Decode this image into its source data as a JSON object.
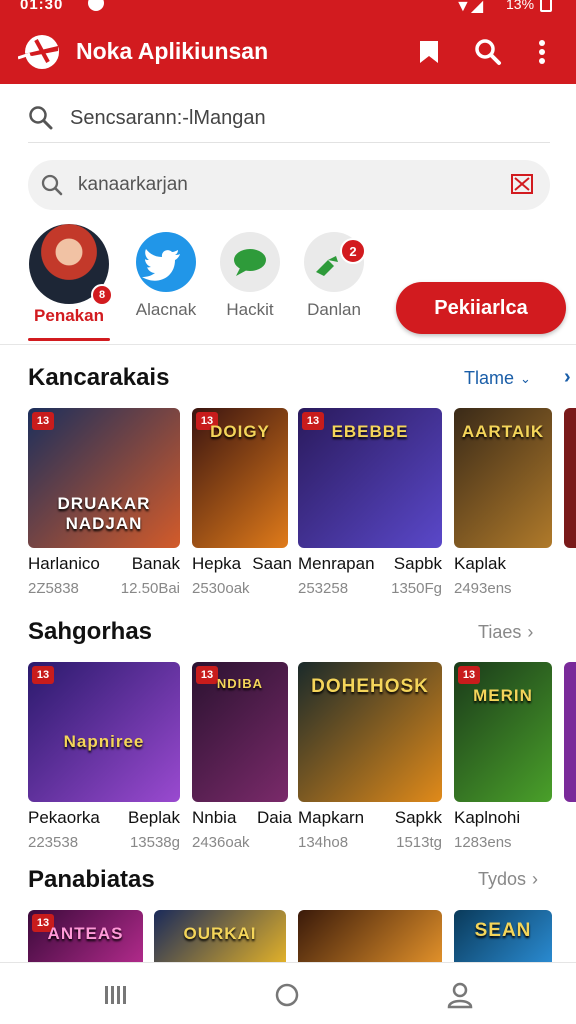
{
  "status_bar": {
    "time": "01:30",
    "battery": "13%"
  },
  "app_bar": {
    "title": "Noka Aplikiunsan",
    "icons": [
      "app-logo-icon",
      "bookmark-icon",
      "search-icon",
      "more-vertical-icon"
    ]
  },
  "search": {
    "main_placeholder": "Sencsarann:-lMangan",
    "filter_value": "kanaarkarjan"
  },
  "categories": [
    {
      "label": "Penakan",
      "icon": "avatar-icon",
      "badge": "8",
      "active": true
    },
    {
      "label": "Alacnak",
      "icon": "bird-icon"
    },
    {
      "label": "Hackit",
      "icon": "chat-icon"
    },
    {
      "label": "Danlan",
      "icon": "game-icon",
      "badge": "2"
    }
  ],
  "install_button": "Pekiiarlca",
  "sections": [
    {
      "title": "Kancarakais",
      "more": "Tlame",
      "items": [
        {
          "name_a": "Harlanico",
          "name_b": "Banak",
          "meta_a": "2Z5838",
          "meta_b": "12.50Bai",
          "age": "13",
          "caption": "DRUAKAR NADJAN",
          "colors": [
            "#1c2f5c",
            "#d35b2a"
          ]
        },
        {
          "name_a": "Hepka",
          "name_b": "Saan",
          "meta_a": "2530oak",
          "meta_b": "",
          "age": "13",
          "caption": "DOIGY",
          "colors": [
            "#3a1410",
            "#e07b1a"
          ]
        },
        {
          "name_a": "Menrapan",
          "name_b": "Sapbk",
          "meta_a": "253258",
          "meta_b": "1350Fg",
          "age": "13",
          "caption": "EBEBBE",
          "colors": [
            "#2a1a5c",
            "#5a48c9"
          ]
        },
        {
          "name_a": "Kaplak",
          "name_b": "",
          "meta_a": "2493ens",
          "meta_b": "",
          "age": "",
          "caption": "AARTAIK",
          "colors": [
            "#3a2a18",
            "#b07a2a"
          ]
        }
      ]
    },
    {
      "title": "Sahgorhas",
      "more": "Tiaes",
      "items": [
        {
          "name_a": "Pekaorka",
          "name_b": "Beplak",
          "meta_a": "223538",
          "meta_b": "13538g",
          "age": "13",
          "caption": "Napniree",
          "colors": [
            "#2a1a6c",
            "#9a4ad0"
          ]
        },
        {
          "name_a": "Nnbia",
          "name_b": "Daia",
          "meta_a": "2436oak",
          "meta_b": "",
          "age": "13",
          "caption": "NDIBA",
          "colors": [
            "#2a1230",
            "#7a2a6a"
          ]
        },
        {
          "name_a": "Mapkarn",
          "name_b": "Sapkk",
          "meta_a": "134ho8",
          "meta_b": "1513tg",
          "age": "",
          "caption": "DOHEHOSK",
          "colors": [
            "#1a2a2a",
            "#e08a1a"
          ]
        },
        {
          "name_a": "Kaplnohi",
          "name_b": "",
          "meta_a": "1283ens",
          "meta_b": "",
          "age": "13",
          "caption": "MERIN",
          "colors": [
            "#1a3a1a",
            "#4aa02a"
          ]
        }
      ]
    },
    {
      "title": "Panabiatas",
      "more": "Tydos",
      "items": [
        {
          "name_a": "",
          "name_b": "",
          "meta_a": "",
          "meta_b": "",
          "age": "13",
          "caption": "ANTEAS",
          "colors": [
            "#3a0a3a",
            "#b02a8a"
          ]
        },
        {
          "name_a": "",
          "name_b": "",
          "meta_a": "",
          "meta_b": "",
          "age": "",
          "caption": "OURKAI",
          "colors": [
            "#1a2a5a",
            "#e0b02a"
          ]
        },
        {
          "name_a": "",
          "name_b": "",
          "meta_a": "",
          "meta_b": "",
          "age": "",
          "caption": "",
          "colors": [
            "#3a1a0a",
            "#e0902a"
          ]
        },
        {
          "name_a": "",
          "name_b": "",
          "meta_a": "",
          "meta_b": "",
          "age": "",
          "caption": "SEAN",
          "colors": [
            "#0a3a5a",
            "#2a8ad0"
          ]
        }
      ]
    }
  ],
  "bottom_nav": [
    "recents-icon",
    "home-icon",
    "profile-icon"
  ]
}
